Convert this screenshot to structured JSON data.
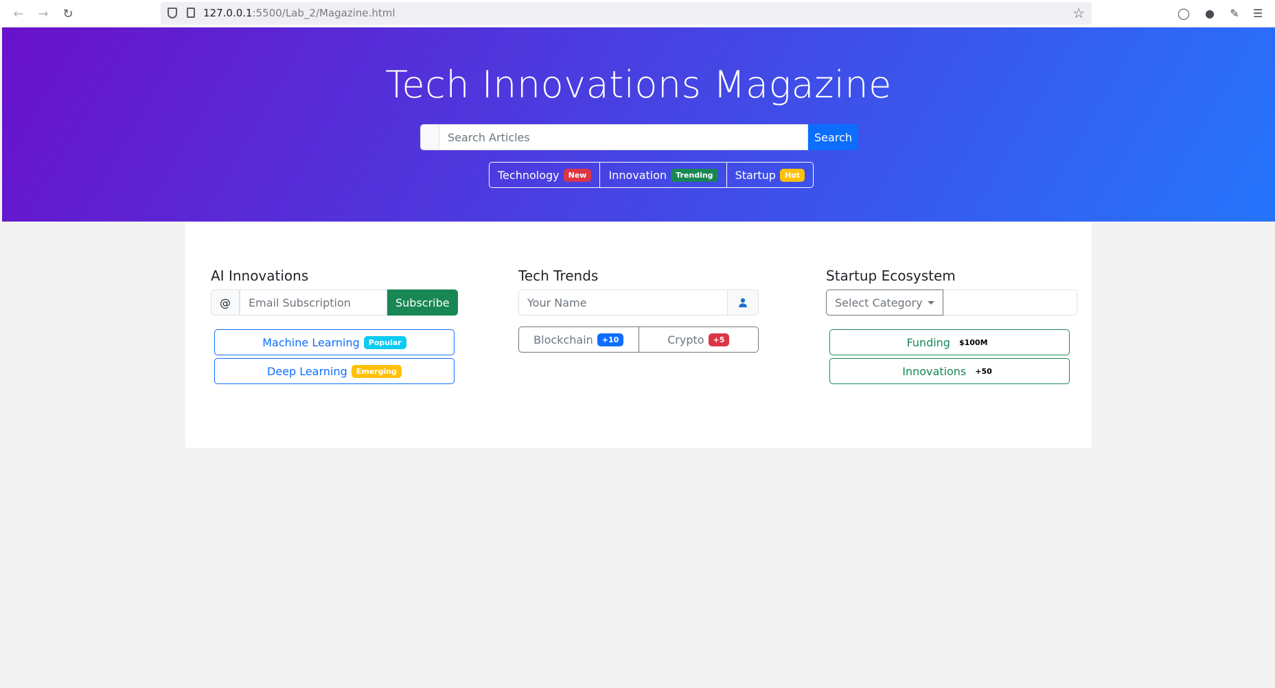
{
  "browser": {
    "url_host": "127.0.0.1",
    "url_rest": ":5500/Lab_2/Magazine.html"
  },
  "hero": {
    "title": "Tech Innovations Magazine",
    "search_placeholder": "Search Articles",
    "search_button": "Search",
    "categories": [
      {
        "label": "Technology",
        "badge": "New",
        "badge_color": "#dc3545"
      },
      {
        "label": "Innovation",
        "badge": "Trending",
        "badge_color": "#198754"
      },
      {
        "label": "Startup",
        "badge": "Hot",
        "badge_color": "#ffc107"
      }
    ],
    "gradient_start": "#6a11cb",
    "gradient_end": "#2575fc"
  },
  "ai": {
    "title": "AI Innovations",
    "at_symbol": "@",
    "email_placeholder": "Email Subscription",
    "subscribe_button": "Subscribe",
    "topics": [
      {
        "label": "Machine Learning",
        "badge": "Popular"
      },
      {
        "label": "Deep Learning",
        "badge": "Emerging"
      }
    ]
  },
  "trends": {
    "title": "Tech Trends",
    "name_placeholder": "Your Name",
    "user_icon": "user-icon",
    "items": [
      {
        "label": "Blockchain",
        "badge": "+10"
      },
      {
        "label": "Crypto",
        "badge": "+5"
      }
    ]
  },
  "startup": {
    "title": "Startup Ecosystem",
    "select_label": "Select Category",
    "items": [
      {
        "label": "Funding",
        "badge": "$100M"
      },
      {
        "label": "Innovations",
        "badge": "+50"
      }
    ]
  }
}
